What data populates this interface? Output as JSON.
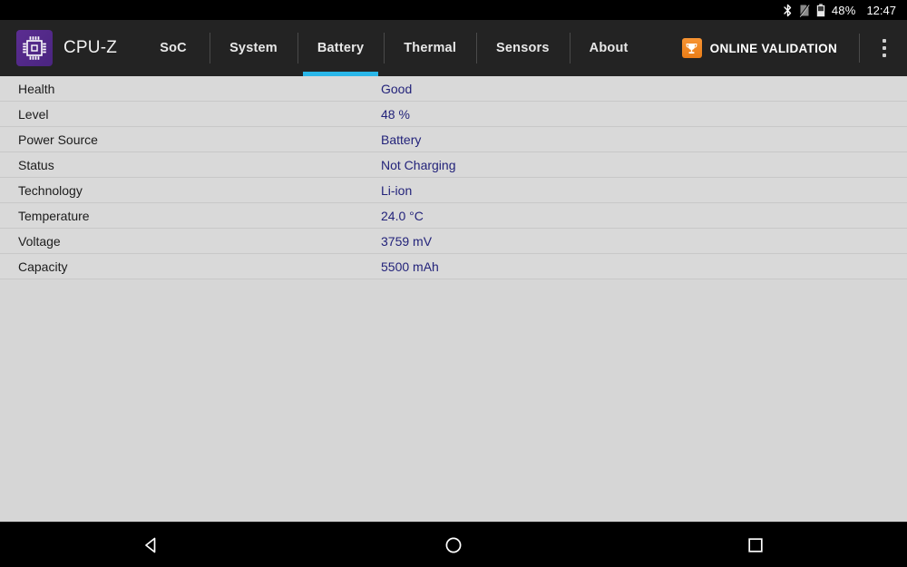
{
  "statusbar": {
    "bluetooth_icon": "bluetooth-icon",
    "nosim_icon": "no-sim-icon",
    "battery_icon": "battery-icon",
    "battery_percent": "48%",
    "time": "12:47"
  },
  "toolbar": {
    "app_icon": "cpu-chip-icon",
    "app_title": "CPU-Z",
    "tabs": [
      {
        "label": "SoC",
        "active": false
      },
      {
        "label": "System",
        "active": false
      },
      {
        "label": "Battery",
        "active": true
      },
      {
        "label": "Thermal",
        "active": false
      },
      {
        "label": "Sensors",
        "active": false
      },
      {
        "label": "About",
        "active": false
      }
    ],
    "validation_icon": "trophy-icon",
    "validation_label": "ONLINE VALIDATION",
    "overflow_icon": "more-vertical-icon",
    "accent_color": "#29b6e8",
    "background_color": "#232323"
  },
  "battery": {
    "rows": [
      {
        "label": "Health",
        "value": "Good"
      },
      {
        "label": "Level",
        "value": "48 %"
      },
      {
        "label": "Power Source",
        "value": "Battery"
      },
      {
        "label": "Status",
        "value": "Not Charging"
      },
      {
        "label": "Technology",
        "value": "Li-ion"
      },
      {
        "label": "Temperature",
        "value": "24.0 °C"
      },
      {
        "label": "Voltage",
        "value": "3759 mV"
      },
      {
        "label": "Capacity",
        "value": "5500 mAh"
      }
    ],
    "value_color": "#23237a",
    "background_color": "#d6d6d6"
  },
  "navbar": {
    "back_icon": "back-triangle-icon",
    "home_icon": "home-circle-icon",
    "recents_icon": "recents-square-icon"
  }
}
